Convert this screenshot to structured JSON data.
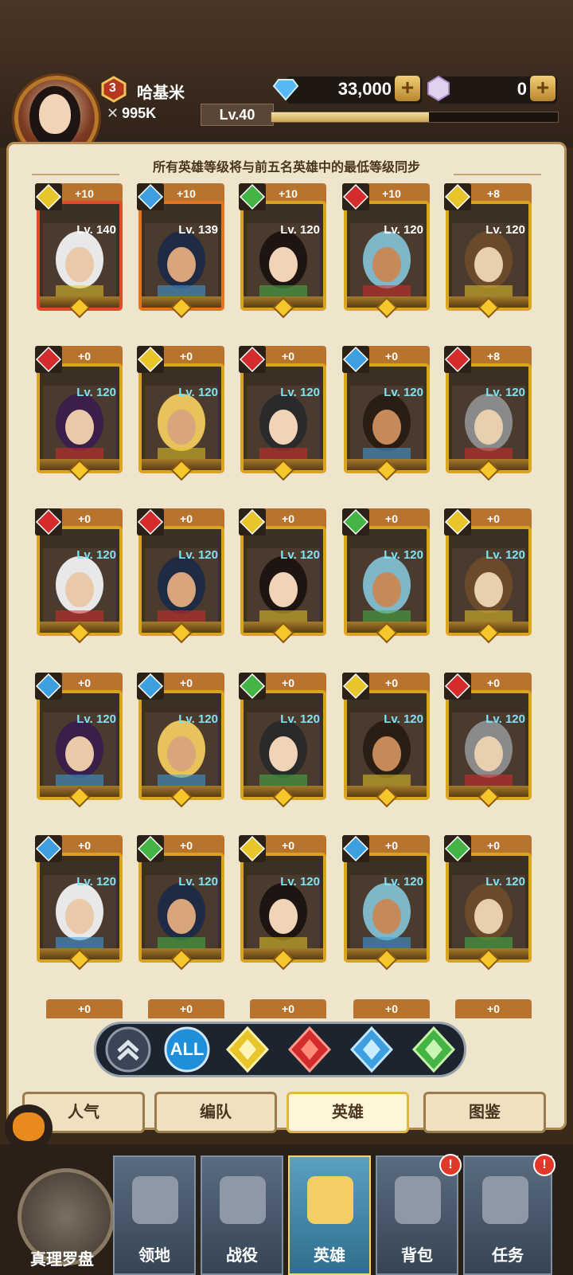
{
  "player": {
    "name": "哈基米",
    "rank": "3",
    "power": "995K",
    "level": "Lv.40",
    "exp_fraction": 0.55
  },
  "currency": {
    "diamonds": "33,000",
    "crystals": "0"
  },
  "banner": "所有英雄等级将与前五名英雄中的最低等级同步",
  "heroes": [
    {
      "stars": "+10",
      "level": "Lv. 140",
      "element": "yellow",
      "frame": "red",
      "lvclass": ""
    },
    {
      "stars": "+10",
      "level": "Lv. 139",
      "element": "blue",
      "frame": "orange",
      "lvclass": ""
    },
    {
      "stars": "+10",
      "level": "Lv. 120",
      "element": "green",
      "frame": "gold",
      "lvclass": ""
    },
    {
      "stars": "+10",
      "level": "Lv. 120",
      "element": "red",
      "frame": "gold",
      "lvclass": ""
    },
    {
      "stars": "+8",
      "level": "Lv. 120",
      "element": "yellow",
      "frame": "gold",
      "lvclass": ""
    },
    {
      "stars": "+0",
      "level": "Lv. 120",
      "element": "red",
      "frame": "gold",
      "lvclass": "cyan"
    },
    {
      "stars": "+0",
      "level": "Lv. 120",
      "element": "yellow",
      "frame": "gold",
      "lvclass": "cyan"
    },
    {
      "stars": "+0",
      "level": "Lv. 120",
      "element": "red",
      "frame": "gold",
      "lvclass": "cyan"
    },
    {
      "stars": "+0",
      "level": "Lv. 120",
      "element": "blue",
      "frame": "gold",
      "lvclass": "cyan"
    },
    {
      "stars": "+8",
      "level": "Lv. 120",
      "element": "red",
      "frame": "gold",
      "lvclass": "cyan"
    },
    {
      "stars": "+0",
      "level": "Lv. 120",
      "element": "red",
      "frame": "gold",
      "lvclass": "cyan"
    },
    {
      "stars": "+0",
      "level": "Lv. 120",
      "element": "red",
      "frame": "gold",
      "lvclass": "cyan"
    },
    {
      "stars": "+0",
      "level": "Lv. 120",
      "element": "yellow",
      "frame": "gold",
      "lvclass": "cyan"
    },
    {
      "stars": "+0",
      "level": "Lv. 120",
      "element": "green",
      "frame": "gold",
      "lvclass": "cyan"
    },
    {
      "stars": "+0",
      "level": "Lv. 120",
      "element": "yellow",
      "frame": "gold",
      "lvclass": "cyan"
    },
    {
      "stars": "+0",
      "level": "Lv. 120",
      "element": "blue",
      "frame": "gold",
      "lvclass": "cyan"
    },
    {
      "stars": "+0",
      "level": "Lv. 120",
      "element": "blue",
      "frame": "gold",
      "lvclass": "cyan"
    },
    {
      "stars": "+0",
      "level": "Lv. 120",
      "element": "green",
      "frame": "gold",
      "lvclass": "cyan"
    },
    {
      "stars": "+0",
      "level": "Lv. 120",
      "element": "yellow",
      "frame": "gold",
      "lvclass": "cyan"
    },
    {
      "stars": "+0",
      "level": "Lv. 120",
      "element": "red",
      "frame": "gold",
      "lvclass": "cyan"
    },
    {
      "stars": "+0",
      "level": "Lv. 120",
      "element": "blue",
      "frame": "gold",
      "lvclass": "cyan"
    },
    {
      "stars": "+0",
      "level": "Lv. 120",
      "element": "green",
      "frame": "gold",
      "lvclass": "cyan"
    },
    {
      "stars": "+0",
      "level": "Lv. 120",
      "element": "yellow",
      "frame": "gold",
      "lvclass": "cyan"
    },
    {
      "stars": "+0",
      "level": "Lv. 120",
      "element": "blue",
      "frame": "gold",
      "lvclass": "cyan"
    },
    {
      "stars": "+0",
      "level": "Lv. 120",
      "element": "green",
      "frame": "gold",
      "lvclass": "cyan"
    }
  ],
  "partial_row": [
    "+0",
    "+0",
    "+0",
    "+0",
    "+0"
  ],
  "filters": {
    "all": "ALL"
  },
  "tabs": [
    "人气",
    "编队",
    "英雄",
    "图鉴"
  ],
  "nav": [
    "真理罗盘",
    "领地",
    "战役",
    "英雄",
    "背包",
    "任务"
  ],
  "nav_badges": {
    "bag": "!",
    "quest": "!"
  },
  "colors": {
    "yellow": "#e8c52a",
    "blue": "#3e9fe0",
    "green": "#44b445",
    "red": "#d42c2c",
    "gold": "#d9a420"
  }
}
